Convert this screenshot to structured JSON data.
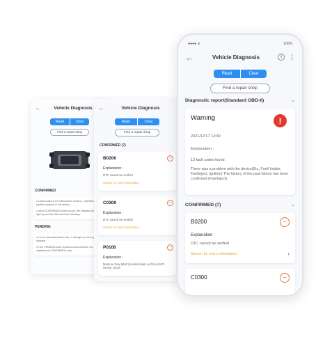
{
  "left_phone": {
    "title": "Vehicle Diagnosis",
    "read": "Read",
    "clear": "Clear",
    "repair": "Find a repair shop",
    "confirmed": "CONFIRMED",
    "confirmed_text_1": "• A fault codes in DTC(Electronic Control...) identifies a problem present in the vehicle...",
    "confirmed_text_2": "• When CONFIRMED mode occurs, the indicator will not light up and the data will clear following...",
    "pending": "PENDING",
    "pending_text_1": "• It is an intermittent fault code, it will light up the engine indicator.",
    "pending_text_2": "• If the PENDING code reoccurs a second time, it is classified as CONFIRMED code..."
  },
  "mid_phone": {
    "title": "Vehicle Diagnosis",
    "read": "Read",
    "clear": "Clear",
    "repair": "Find a repair shop",
    "confirmed": "CONFIRMED (7)",
    "codes": [
      {
        "code": "B0200",
        "expl": "Explanation :",
        "desc": "DTC cannot be verified",
        "link": "Search for more information"
      },
      {
        "code": "C0300",
        "expl": "Explanation :",
        "desc": "DTC cannot be verified",
        "link": "Search for more information"
      },
      {
        "code": "P0100",
        "expl": "Explanation :",
        "desc": "Mass air flow (MAF) sensor/mass air flow (VAF) sensor circuit",
        "link": ""
      }
    ]
  },
  "front_phone": {
    "status_time": "●●●● ≋",
    "status_battery": "100%",
    "title": "Vehicle Diagnosis",
    "read": "Read",
    "clear": "Clear",
    "repair": "Find a repair shop",
    "report_title": "Diagnostic report(Standard OBD-II)",
    "warning_title": "Warning",
    "warning_date": "2021/12/17 14:49",
    "explanation": "Explanation :",
    "fault_count": "13 fault codes found.",
    "fault_text": "There was a problem with the device(Etc, Fuel/ Intake, FuelInject, Ignition) The history of the past failure has been confirmed (FuelInject)",
    "confirmed": "CONFIRMED (7)",
    "codes": [
      {
        "code": "B0200",
        "expl": "Explanation :",
        "desc": "DTC cannot be verified",
        "link": "Search for more information"
      },
      {
        "code": "C0300"
      }
    ]
  }
}
